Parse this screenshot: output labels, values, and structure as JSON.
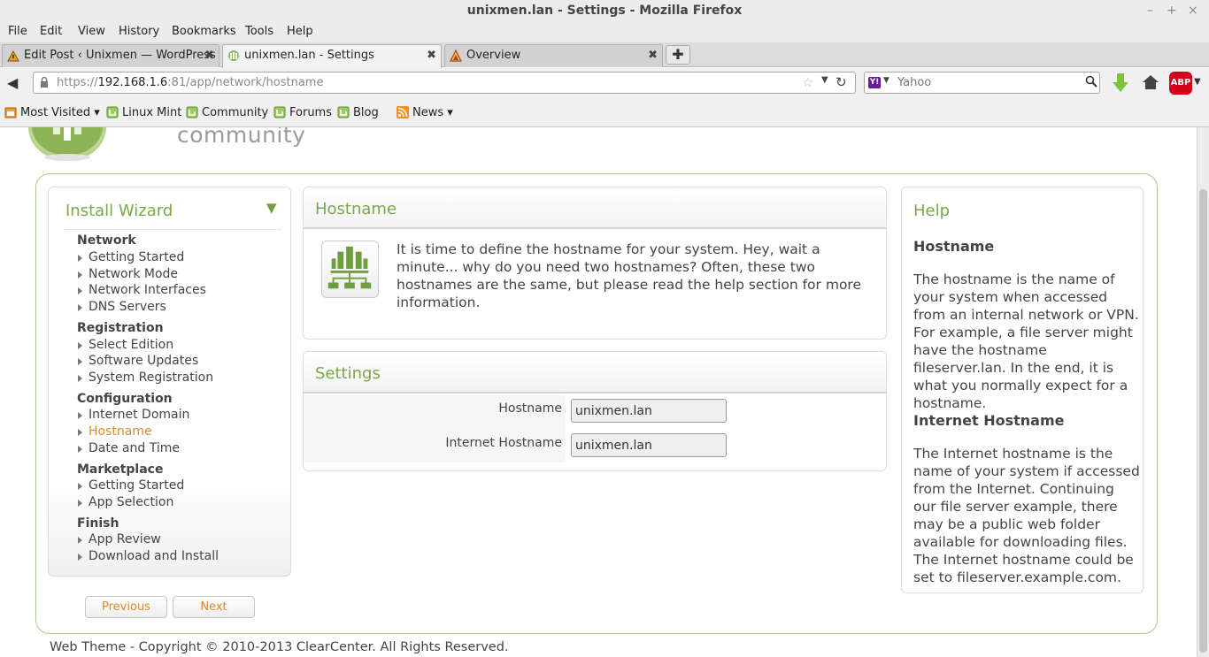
{
  "window": {
    "title": "unixmen.lan - Settings - Mozilla Firefox",
    "controls": [
      "–",
      "+",
      "×"
    ]
  },
  "menu": {
    "file": "File",
    "edit": "Edit",
    "view": "View",
    "history": "History",
    "bookmarks": "Bookmarks",
    "tools": "Tools",
    "help": "Help"
  },
  "tabs": [
    {
      "label": "Edit Post ‹ Unixmen — WordPress",
      "icon": "wordpress-icon"
    },
    {
      "label": "unixmen.lan - Settings",
      "icon": "clearos-icon",
      "active": true
    },
    {
      "label": "Overview",
      "icon": "warning-icon"
    }
  ],
  "tab_close": "✖",
  "new_tab": "✚",
  "nav": {
    "url_prefix": "https://",
    "url_host": "192.168.1.6",
    "url_rest": ":81/app/network/hostname",
    "search_placeholder": "Yahoo",
    "search_engine_badge": "Y!",
    "abp_label": "ABP"
  },
  "bookmarks": [
    {
      "label": "Most Visited ▾",
      "icon": "bookmark-folder-icon"
    },
    {
      "label": "Linux Mint",
      "icon": "mint-icon"
    },
    {
      "label": "Community",
      "icon": "mint-icon"
    },
    {
      "label": "Forums",
      "icon": "mint-icon"
    },
    {
      "label": "Blog",
      "icon": "mint-icon"
    },
    {
      "label": "News ▾",
      "icon": "rss-icon"
    }
  ],
  "page": {
    "logo_text": "community",
    "wizard": {
      "title": "Install Wizard",
      "sections": [
        {
          "name": "Network",
          "items": [
            "Getting Started",
            "Network Mode",
            "Network Interfaces",
            "DNS Servers"
          ]
        },
        {
          "name": "Registration",
          "items": [
            "Select Edition",
            "Software Updates",
            "System Registration"
          ]
        },
        {
          "name": "Configuration",
          "items": [
            "Internet Domain",
            "Hostname",
            "Date and Time"
          ]
        },
        {
          "name": "Marketplace",
          "items": [
            "Getting Started",
            "App Selection"
          ]
        },
        {
          "name": "Finish",
          "items": [
            "App Review",
            "Download and Install"
          ]
        }
      ],
      "current_item": "Hostname"
    },
    "buttons": {
      "previous": "Previous",
      "next": "Next"
    },
    "hostname_panel": {
      "title": "Hostname",
      "intro": "It is time to define the hostname for your system. Hey, wait a minute... why do you need two hostnames? Often, these two hostnames are the same, but please read the help section for more information."
    },
    "settings_panel": {
      "title": "Settings",
      "hostname_label": "Hostname",
      "hostname_value": "unixmen.lan",
      "internet_hostname_label": "Internet Hostname",
      "internet_hostname_value": "unixmen.lan"
    },
    "help": {
      "title": "Help",
      "h1": "Hostname",
      "p1": "The hostname is the name of your system when accessed from an internal network or VPN. For example, a file server might have the hostname fileserver.lan. In the end, it is what you normally expect for a hostname.",
      "h2": "Internet Hostname",
      "p2": "The Internet hostname is the name of your system if accessed from the Internet. Continuing our file server example, there may be a public web folder available for downloading files. The Internet hostname could be set to fileserver.example.com."
    },
    "footer": "Web Theme - Copyright © 2010-2013 ClearCenter. All Rights Reserved."
  },
  "colors": {
    "accent_green": "#7aa84a",
    "link_orange": "#d98a2e",
    "abp_red": "#d0021b"
  }
}
